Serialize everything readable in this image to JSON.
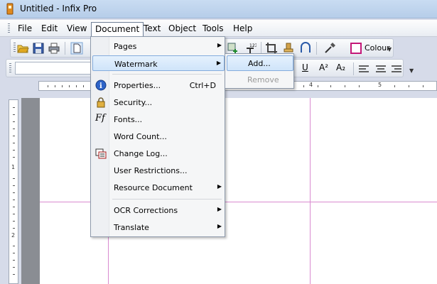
{
  "window": {
    "title": "Untitled - Infix Pro"
  },
  "menubar": {
    "items": [
      "File",
      "Edit",
      "View",
      "Document",
      "Text",
      "Object",
      "Tools",
      "Help"
    ],
    "active": "Document"
  },
  "toolbar": {
    "colour_label": "Colour",
    "colour_swatch": "#c41878",
    "icons": [
      "open-folder-icon",
      "save-icon",
      "print-icon",
      "page-icon",
      "add-object-icon",
      "text-number-icon",
      "crop-icon",
      "stamp-icon",
      "curve-icon",
      "eyedropper-icon"
    ],
    "format_icons": [
      "underline",
      "superscript",
      "subscript",
      "align-left",
      "align-center",
      "align-right"
    ]
  },
  "format": {
    "underline": "U",
    "superscript": "A²",
    "subscript": "A₂"
  },
  "ruler": {
    "h_numbers": [
      "4",
      "5"
    ],
    "v_numbers": [
      "1",
      "2"
    ]
  },
  "document_menu": {
    "items": [
      {
        "label": "Pages",
        "submenu": true
      },
      {
        "label": "Watermark",
        "submenu": true,
        "highlighted": true
      },
      {
        "label": "Properties...",
        "shortcut": "Ctrl+D",
        "icon": "info-icon"
      },
      {
        "label": "Security...",
        "icon": "lock-icon"
      },
      {
        "label": "Fonts...",
        "icon": "font-icon"
      },
      {
        "label": "Word Count..."
      },
      {
        "label": "Change Log...",
        "icon": "change-log-icon"
      },
      {
        "label": "User Restrictions..."
      },
      {
        "label": "Resource Document",
        "submenu": true
      },
      {
        "label": "OCR Corrections",
        "submenu": true
      },
      {
        "label": "Translate",
        "submenu": true
      }
    ]
  },
  "watermark_submenu": {
    "items": [
      {
        "label": "Add...",
        "highlighted": true
      },
      {
        "label": "Remove",
        "disabled": true
      }
    ]
  },
  "icons": {
    "info": "i",
    "font": "Ff",
    "submenu_arrow": "▶",
    "overflow": "▼"
  }
}
